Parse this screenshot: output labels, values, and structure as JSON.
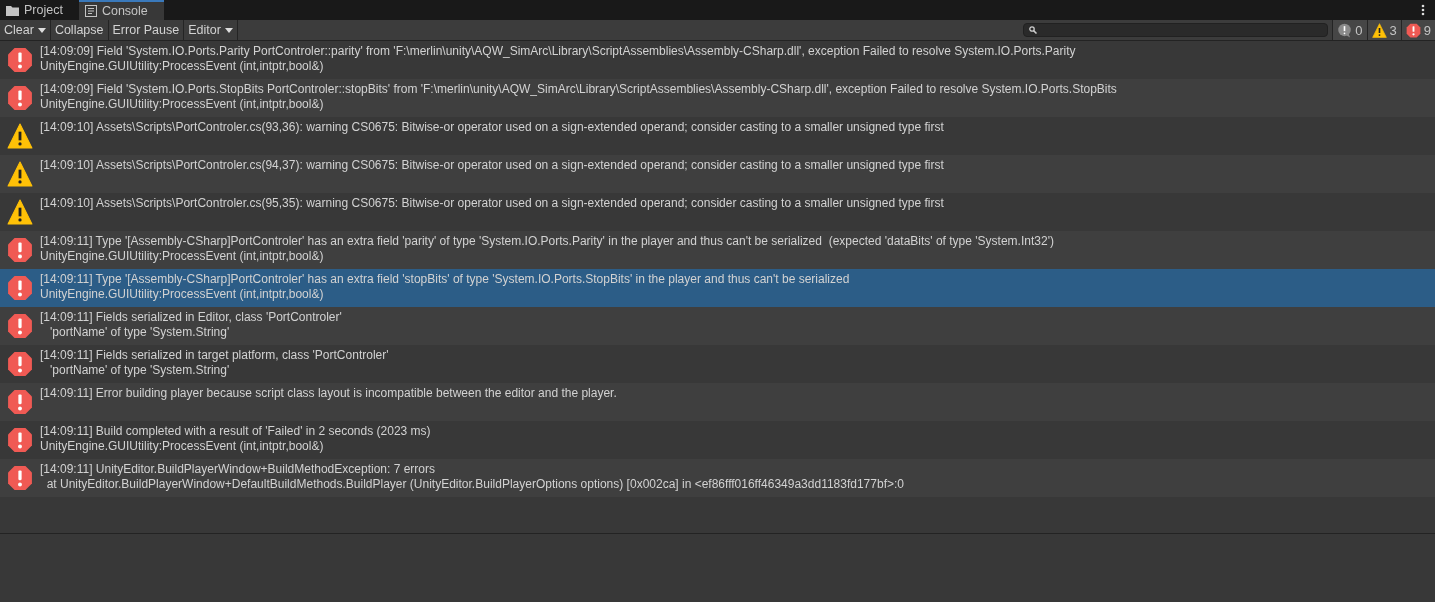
{
  "tabs": [
    {
      "label": "Project",
      "kind": "folder",
      "selected": false
    },
    {
      "label": "Console",
      "kind": "console",
      "selected": true
    }
  ],
  "toolbar": {
    "buttons": [
      {
        "label": "Clear",
        "dropdown": true
      },
      {
        "label": "Collapse",
        "dropdown": false
      },
      {
        "label": "Error Pause",
        "dropdown": false
      },
      {
        "label": "Editor",
        "dropdown": true
      }
    ],
    "counters": [
      {
        "kind": "info",
        "count": "0"
      },
      {
        "kind": "warning",
        "count": "3"
      },
      {
        "kind": "error",
        "count": "9"
      }
    ]
  },
  "messages": [
    {
      "kind": "error",
      "selected": false,
      "lines": [
        "[14:09:09] Field 'System.IO.Ports.Parity PortControler::parity' from 'F:\\merlin\\unity\\AQW_SimArc\\Library\\ScriptAssemblies\\Assembly-CSharp.dll', exception Failed to resolve System.IO.Ports.Parity",
        "UnityEngine.GUIUtility:ProcessEvent (int,intptr,bool&)"
      ]
    },
    {
      "kind": "error",
      "selected": false,
      "lines": [
        "[14:09:09] Field 'System.IO.Ports.StopBits PortControler::stopBits' from 'F:\\merlin\\unity\\AQW_SimArc\\Library\\ScriptAssemblies\\Assembly-CSharp.dll', exception Failed to resolve System.IO.Ports.StopBits",
        "UnityEngine.GUIUtility:ProcessEvent (int,intptr,bool&)"
      ]
    },
    {
      "kind": "warning",
      "selected": false,
      "lines": [
        "[14:09:10] Assets\\Scripts\\PortControler.cs(93,36): warning CS0675: Bitwise-or operator used on a sign-extended operand; consider casting to a smaller unsigned type first"
      ]
    },
    {
      "kind": "warning",
      "selected": false,
      "lines": [
        "[14:09:10] Assets\\Scripts\\PortControler.cs(94,37): warning CS0675: Bitwise-or operator used on a sign-extended operand; consider casting to a smaller unsigned type first"
      ]
    },
    {
      "kind": "warning",
      "selected": false,
      "lines": [
        "[14:09:10] Assets\\Scripts\\PortControler.cs(95,35): warning CS0675: Bitwise-or operator used on a sign-extended operand; consider casting to a smaller unsigned type first"
      ]
    },
    {
      "kind": "error",
      "selected": false,
      "lines": [
        "[14:09:11] Type '[Assembly-CSharp]PortControler' has an extra field 'parity' of type 'System.IO.Ports.Parity' in the player and thus can't be serialized  (expected 'dataBits' of type 'System.Int32')",
        "UnityEngine.GUIUtility:ProcessEvent (int,intptr,bool&)"
      ]
    },
    {
      "kind": "error",
      "selected": true,
      "lines": [
        "[14:09:11] Type '[Assembly-CSharp]PortControler' has an extra field 'stopBits' of type 'System.IO.Ports.StopBits' in the player and thus can't be serialized",
        "UnityEngine.GUIUtility:ProcessEvent (int,intptr,bool&)"
      ]
    },
    {
      "kind": "error",
      "selected": false,
      "lines": [
        "[14:09:11] Fields serialized in Editor, class 'PortControler'",
        "   'portName' of type 'System.String'"
      ]
    },
    {
      "kind": "error",
      "selected": false,
      "lines": [
        "[14:09:11] Fields serialized in target platform, class 'PortControler'",
        "   'portName' of type 'System.String'"
      ]
    },
    {
      "kind": "error",
      "selected": false,
      "lines": [
        "[14:09:11] Error building player because script class layout is incompatible between the editor and the player."
      ]
    },
    {
      "kind": "error",
      "selected": false,
      "lines": [
        "[14:09:11] Build completed with a result of 'Failed' in 2 seconds (2023 ms)",
        "UnityEngine.GUIUtility:ProcessEvent (int,intptr,bool&)"
      ]
    },
    {
      "kind": "error",
      "selected": false,
      "lines": [
        "[14:09:11] UnityEditor.BuildPlayerWindow+BuildMethodException: 7 errors",
        "  at UnityEditor.BuildPlayerWindow+DefaultBuildMethods.BuildPlayer (UnityEditor.BuildPlayerOptions options) [0x002ca] in <ef86fff016ff46349a3dd1183fd177bf>:0"
      ]
    }
  ]
}
